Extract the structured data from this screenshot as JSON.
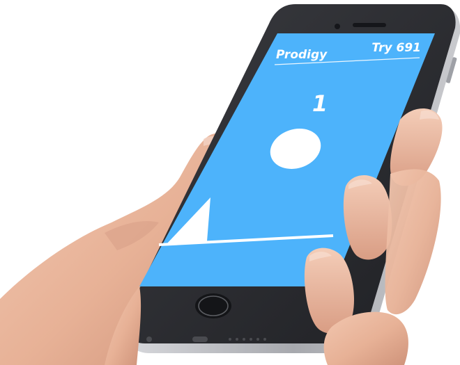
{
  "game": {
    "title": "Prodigy",
    "attempt_label": "Try 691",
    "score": "1"
  },
  "colors": {
    "screen_background": "#4db3fb",
    "foreground": "#ffffff",
    "phone_body": "#2a2b2f",
    "phone_frame": "#b9bbc0",
    "skin": "#e8b49a"
  },
  "icons": {
    "player": "ball-icon",
    "obstacle": "spike-icon"
  }
}
